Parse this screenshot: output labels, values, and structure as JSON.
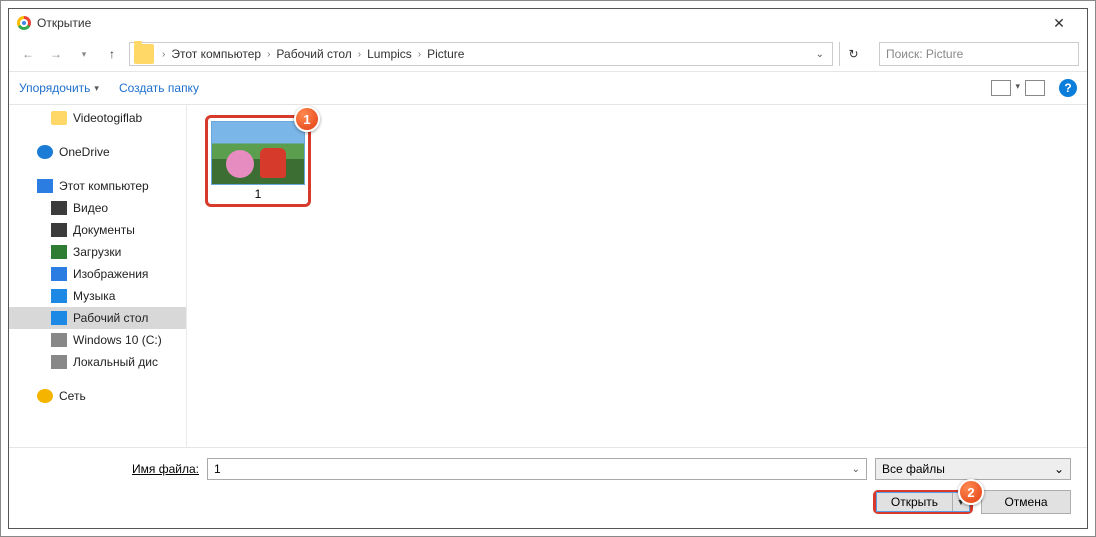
{
  "window": {
    "title": "Открытие"
  },
  "nav": {
    "crumbs": [
      "Этот компьютер",
      "Рабочий стол",
      "Lumpics",
      "Picture"
    ],
    "search_placeholder": "Поиск: Picture"
  },
  "toolbar": {
    "organize": "Упорядочить",
    "newfolder": "Создать папку"
  },
  "sidebar": {
    "items": [
      {
        "label": "Videotogiflab",
        "icon": "ico-folder",
        "indent": 1
      },
      {
        "blank": true
      },
      {
        "label": "OneDrive",
        "icon": "ico-onedrive",
        "indent": 0
      },
      {
        "blank": true
      },
      {
        "label": "Этот компьютер",
        "icon": "ico-pc",
        "indent": 0
      },
      {
        "label": "Видео",
        "icon": "ico-video",
        "indent": 1
      },
      {
        "label": "Документы",
        "icon": "ico-docs",
        "indent": 1
      },
      {
        "label": "Загрузки",
        "icon": "ico-dl",
        "indent": 1
      },
      {
        "label": "Изображения",
        "icon": "ico-pic",
        "indent": 1
      },
      {
        "label": "Музыка",
        "icon": "ico-music",
        "indent": 1
      },
      {
        "label": "Рабочий стол",
        "icon": "ico-desk",
        "indent": 1,
        "selected": true
      },
      {
        "label": "Windows 10 (C:)",
        "icon": "ico-disk",
        "indent": 1
      },
      {
        "label": "Локальный дис",
        "icon": "ico-disk",
        "indent": 1
      },
      {
        "blank": true
      },
      {
        "label": "Сеть",
        "icon": "ico-net",
        "indent": 0
      }
    ]
  },
  "content": {
    "file_caption": "1"
  },
  "callouts": {
    "one": "1",
    "two": "2"
  },
  "footer": {
    "filename_label_pre": "И",
    "filename_label_u": "м",
    "filename_label_post": "я файла:",
    "filename_value": "1",
    "filter": "Все файлы",
    "open": "Открыть",
    "cancel": "Отмена"
  }
}
